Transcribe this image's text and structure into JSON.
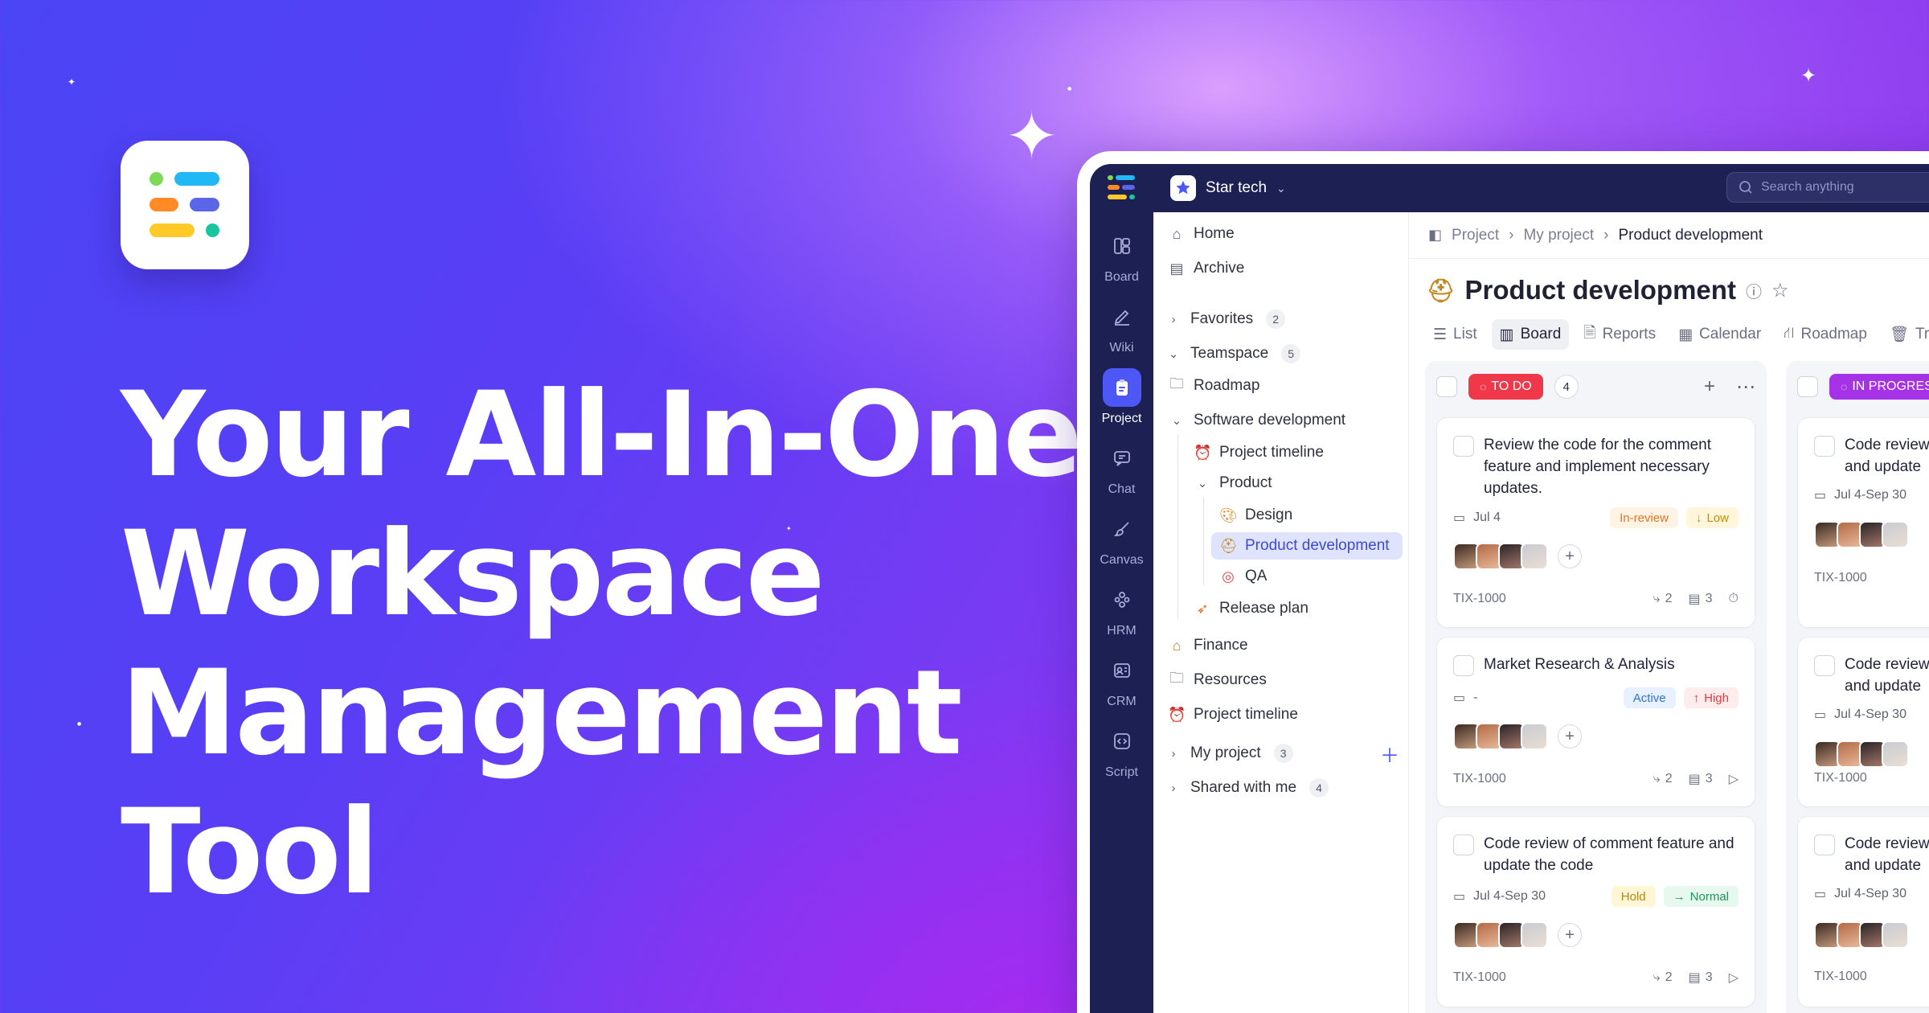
{
  "hero": {
    "title_lines": [
      "Your All-In-One",
      "Workspace",
      "Management",
      "Tool"
    ]
  },
  "app": {
    "workspace_name": "Star tech",
    "search_placeholder": "Search anything",
    "rail": [
      {
        "label": "Board",
        "icon": "board-icon",
        "active": false
      },
      {
        "label": "Wiki",
        "icon": "pen-icon",
        "active": false
      },
      {
        "label": "Project",
        "icon": "clipboard-icon",
        "active": true
      },
      {
        "label": "Chat",
        "icon": "chat-icon",
        "active": false
      },
      {
        "label": "Canvas",
        "icon": "brush-icon",
        "active": false
      },
      {
        "label": "HRM",
        "icon": "people-icon",
        "active": false
      },
      {
        "label": "CRM",
        "icon": "contact-card-icon",
        "active": false
      },
      {
        "label": "Script",
        "icon": "code-icon",
        "active": false
      }
    ],
    "sidebar": {
      "home": "Home",
      "archive": "Archive",
      "favorites": {
        "label": "Favorites",
        "count": "2"
      },
      "teamspace": {
        "label": "Teamspace",
        "count": "5"
      },
      "roadmap": "Roadmap",
      "software_development": "Software development",
      "project_timeline_nested": "Project timeline",
      "product": "Product",
      "design": "Design",
      "product_development": "Product development",
      "qa": "QA",
      "release_plan": "Release plan",
      "finance": "Finance",
      "resources": "Resources",
      "project_timeline": "Project timeline",
      "my_project": {
        "label": "My project",
        "count": "3"
      },
      "shared_with_me": {
        "label": "Shared with me",
        "count": "4"
      }
    },
    "breadcrumb": [
      "Project",
      "My project",
      "Product development"
    ],
    "page_title": "Product development",
    "tabs": [
      "List",
      "Board",
      "Reports",
      "Calendar",
      "Roadmap",
      "Tr"
    ],
    "active_tab": "Board",
    "columns": [
      {
        "status": "TO DO",
        "status_color": "#f0384b",
        "count": "4",
        "cards": [
          {
            "title": "Review the code for the comment feature and implement necessary updates.",
            "date": "Jul 4",
            "status_tag": "In-review",
            "priority": "Low",
            "id": "TIX-1000",
            "subtasks": "2",
            "comments": "3"
          },
          {
            "title": "Market Research & Analysis",
            "date": "-",
            "status_tag": "Active",
            "priority": "High",
            "id": "TIX-1000",
            "subtasks": "2",
            "comments": "3"
          },
          {
            "title": "Code review of comment feature and update the code",
            "date": "Jul 4-Sep 30",
            "status_tag": "Hold",
            "priority": "Normal",
            "id": "TIX-1000",
            "subtasks": "2",
            "comments": "3"
          }
        ]
      },
      {
        "status": "IN PROGRESS",
        "status_color": "#a632e8",
        "cards": [
          {
            "title_line1": "Code review",
            "title_line2": "and update",
            "date": "Jul 4-Sep 30",
            "id": "TIX-1000"
          },
          {
            "title_line1": "Code review",
            "title_line2": "and update",
            "date": "Jul 4-Sep 30",
            "id": "TIX-1000"
          },
          {
            "title_line1": "Code review",
            "title_line2": "and update",
            "date": "Jul 4-Sep 30",
            "id": "TIX-1000"
          }
        ]
      }
    ]
  },
  "colors": {
    "brand_indigo": "#1d2053",
    "accent_blue": "#4c57f5",
    "todo_red": "#f0384b",
    "in_progress_purple": "#a632e8"
  }
}
